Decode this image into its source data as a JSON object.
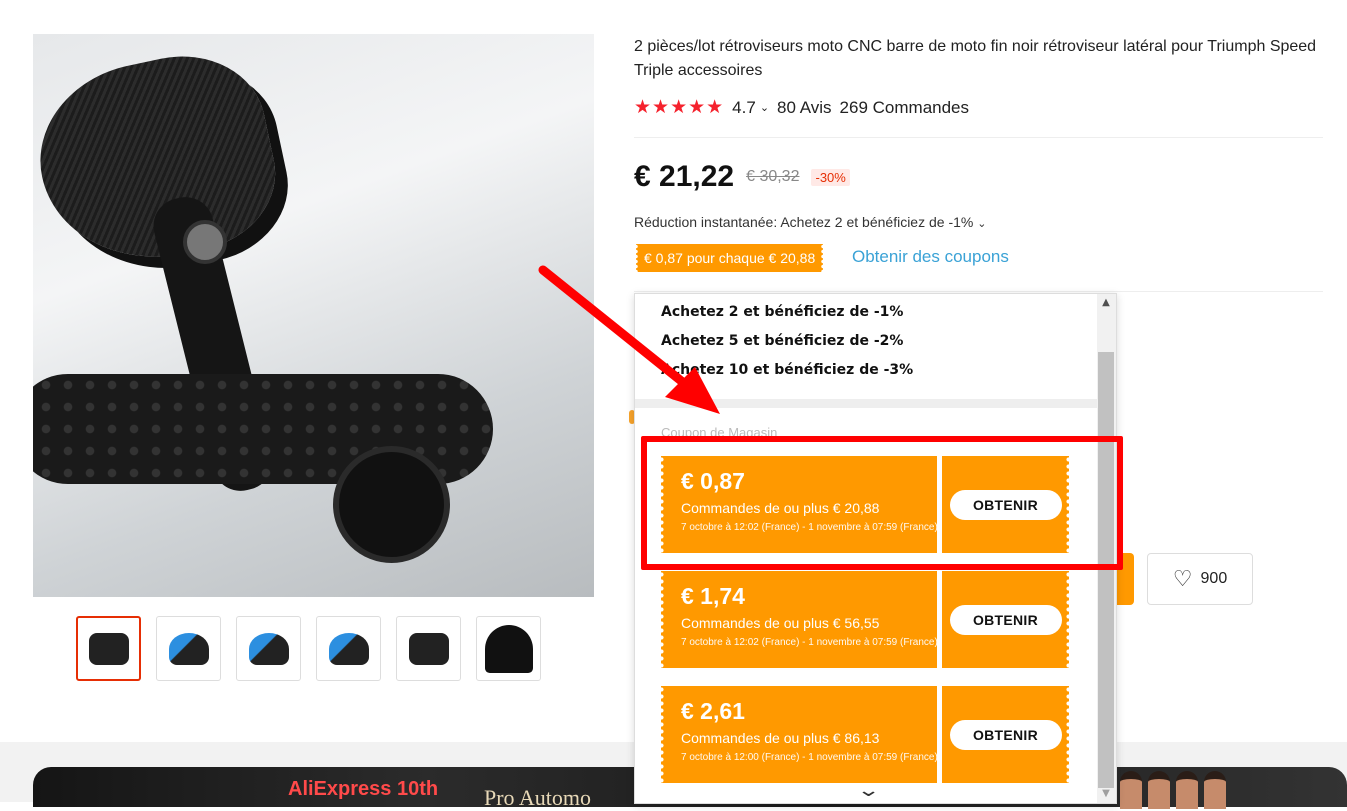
{
  "product": {
    "title": "2 pièces/lot rétroviseurs moto CNC barre de moto fin noir rétroviseur latéral pour Triumph Speed Triple accessoires",
    "stars": "★★★★★",
    "rating": "4.7",
    "reviews": "80 Avis",
    "orders": "269 Commandes",
    "price": "€ 21,22",
    "old_price": "€ 30,32",
    "discount": "-30%",
    "instant_reduction": "Réduction instantanée: Achetez 2 et bénéficiez de -1%",
    "coupon_tag": "€ 0,87 pour chaque € 20,88",
    "get_coupons": "Obtenir des coupons",
    "wishlist_count": "900"
  },
  "thumbnails": [
    {
      "icon": "mirror-thumb-icon"
    },
    {
      "icon": "blue-mirror-thumb-icon"
    },
    {
      "icon": "blue-mirror-pair-thumb-icon"
    },
    {
      "icon": "mirror-set-thumb-icon"
    },
    {
      "icon": "parts-thumb-icon"
    },
    {
      "icon": "mirror-cap-thumb-icon"
    }
  ],
  "popup": {
    "tiers": [
      "Achetez 2 et bénéficiez de -1%",
      "Achetez 5 et bénéficiez de -2%",
      "Achetez 10 et bénéficiez de -3%"
    ],
    "store_coupon_label": "Coupon de Magasin",
    "coupons": [
      {
        "amount": "€ 0,87",
        "min": "Commandes de ou plus € 20,88",
        "dates": "7 octobre à 12:02 (France) - 1 novembre à 07:59 (France)",
        "button": "OBTENIR"
      },
      {
        "amount": "€ 1,74",
        "min": "Commandes de ou plus € 56,55",
        "dates": "7 octobre à 12:02 (France) - 1 novembre à 07:59 (France)",
        "button": "OBTENIR"
      },
      {
        "amount": "€ 2,61",
        "min": "Commandes de ou plus € 86,13",
        "dates": "7 octobre à 12:00 (France) - 1 novembre à 07:59 (France)",
        "button": "OBTENIR"
      }
    ]
  },
  "banner": {
    "title": "AliExpress 10th",
    "subtitle": "Pro Automo"
  },
  "colors": {
    "accent_orange": "#ff9900",
    "star_red": "#f5222d",
    "link_blue": "#3aa2d6",
    "annotation_red": "#ff0000"
  }
}
